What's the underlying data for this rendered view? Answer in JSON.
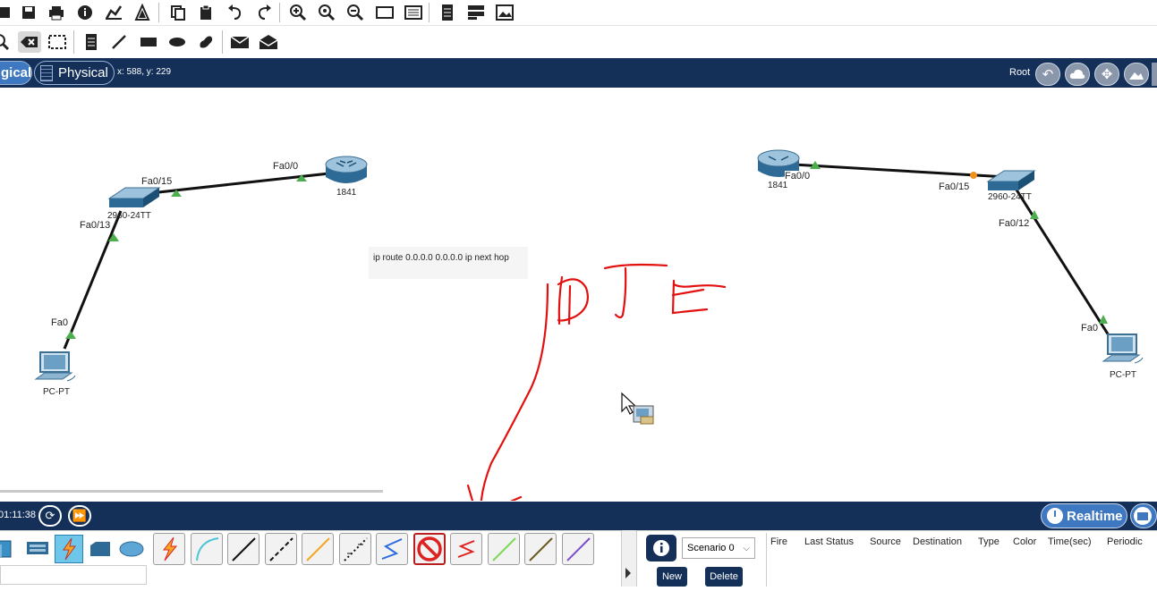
{
  "nav": {
    "logical_tab": "gical",
    "physical_tab": "Physical",
    "coords": "x: 588, y: 229",
    "root_label": "Root"
  },
  "topology": {
    "left": {
      "switch_label": "2960-24TT",
      "router_label": "1841",
      "pc_label": "PC-PT",
      "ports": {
        "sw_to_router": "Fa0/15",
        "router_port": "Fa0/0",
        "sw_to_pc": "Fa0/13",
        "pc_port": "Fa0"
      }
    },
    "right": {
      "router_label": "1841",
      "switch_label": "2960-24TT",
      "pc_label": "PC-PT",
      "ports": {
        "router_port": "Fa0/0",
        "sw_to_router": "Fa0/15",
        "sw_to_pc": "Fa0/12",
        "pc_port": "Fa0"
      }
    },
    "note": "ip route 0.0.0.0 0.0.0.0 ip next hop",
    "annotation": "DTE"
  },
  "simulation": {
    "clock": "01:11:38",
    "mode": "Realtime"
  },
  "panel": {
    "scenario": "Scenario 0",
    "new_button": "New",
    "delete_button": "Delete",
    "columns": [
      "Fire",
      "Last Status",
      "Source",
      "Destination",
      "Type",
      "Color",
      "Time(sec)",
      "Periodic"
    ]
  },
  "colors": {
    "navbar": "#143059",
    "accent": "#3e78c0",
    "link_up": "#4cae4c",
    "link_amber": "#f0901e",
    "annotation": "#e31010"
  },
  "icons": {
    "cables": [
      "auto-cable-icon",
      "console-cable-icon",
      "straight-cable-icon",
      "crossover-cable-icon",
      "fiber-cable-icon",
      "phone-cable-icon",
      "coaxial-cable-icon",
      "serial-dce-cable-icon",
      "serial-dte-cable-icon",
      "octal-cable-icon",
      "iot-cable-icon",
      "usb-cable-icon"
    ]
  }
}
